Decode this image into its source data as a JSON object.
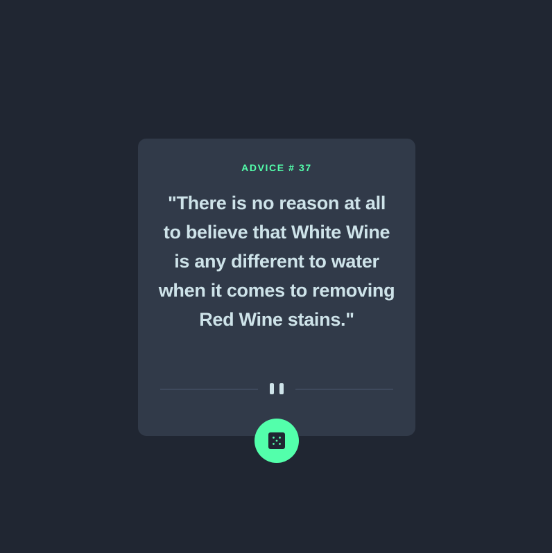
{
  "card": {
    "label": "ADVICE # 37",
    "quote": "\"There is no reason at all to believe that White Wine is any different to water when it comes to removing Red Wine stains.\""
  },
  "icons": {
    "divider": "pause-icon",
    "button": "dice-icon"
  },
  "colors": {
    "background": "#202632",
    "card": "#313a49",
    "accent": "#53ffab",
    "text": "#cee3e9",
    "divider": "#4f5d74"
  }
}
